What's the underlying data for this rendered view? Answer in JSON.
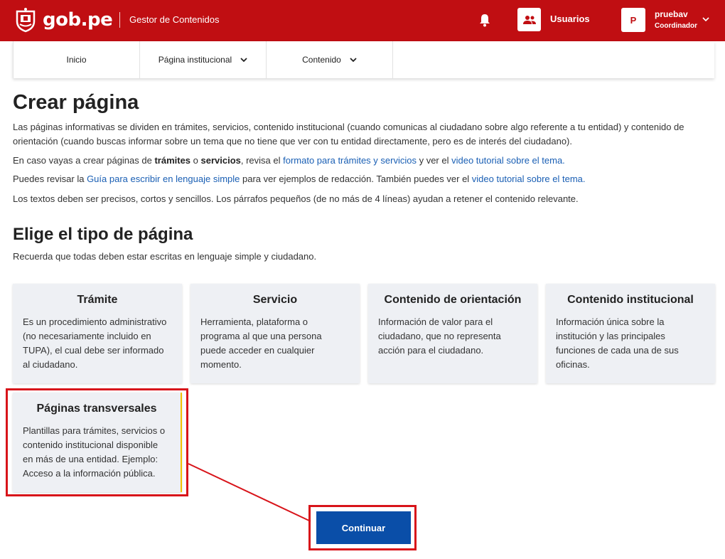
{
  "header": {
    "logo_text": "gob.pe",
    "app_name": "Gestor de Contenidos",
    "users_label": "Usuarios",
    "avatar_initial": "P",
    "user_name": "pruebav",
    "user_role": "Coordinador",
    "brand_color": "#c00e12"
  },
  "nav": {
    "items": [
      {
        "label": "Inicio"
      },
      {
        "label": "Página institucional"
      },
      {
        "label": "Contenido"
      }
    ]
  },
  "page": {
    "title": "Crear página",
    "p1": "Las páginas informativas se dividen en trámites, servicios, contenido institucional (cuando comunicas al ciudadano sobre algo referente a tu entidad) y contenido de orientación (cuando buscas informar sobre un tema que no tiene que ver con tu entidad directamente, pero es de interés del ciudadano).",
    "p2_a": "En caso vayas a crear páginas de ",
    "p2_b": "trámites",
    "p2_c": " o ",
    "p2_d": "servicios",
    "p2_e": ", revisa el ",
    "p2_link1": "formato para trámites y servicios",
    "p2_f": " y ver el ",
    "p2_link2": "video tutorial sobre el tema.",
    "p3_a": "Puedes revisar la ",
    "p3_link1": "Guía para escribir en lenguaje simple",
    "p3_b": " para ver ejemplos de redacción. También puedes ver el ",
    "p3_link2": "video tutorial sobre el tema.",
    "p4": "Los textos deben ser precisos, cortos y sencillos. Los párrafos pequeños (de no más de 4 líneas) ayudan a retener el contenido relevante.",
    "section_title": "Elige el tipo de página",
    "section_sub": "Recuerda que todas deben estar escritas en lenguaje simple y ciudadano."
  },
  "cards": [
    {
      "title": "Trámite",
      "desc": "Es un procedimiento administrativo (no necesariamente incluido en TUPA), el cual debe ser informado al ciudadano."
    },
    {
      "title": "Servicio",
      "desc": "Herramienta, plataforma o programa al que una persona puede acceder en cualquier momento."
    },
    {
      "title": "Contenido de orientación",
      "desc": "Información de valor para el ciudadano, que no representa acción para el ciudadano."
    },
    {
      "title": "Contenido institucional",
      "desc": "Información única sobre la institución y las principales funciones de cada una de sus oficinas."
    },
    {
      "title": "Páginas transversales",
      "desc": "Plantillas para trámites, servicios o contenido institucional disponible en más de una entidad. Ejemplo: Acceso a la información pública."
    }
  ],
  "actions": {
    "continue_label": "Continuar",
    "button_color": "#0a4ea8",
    "highlight_color": "#d8141a"
  }
}
